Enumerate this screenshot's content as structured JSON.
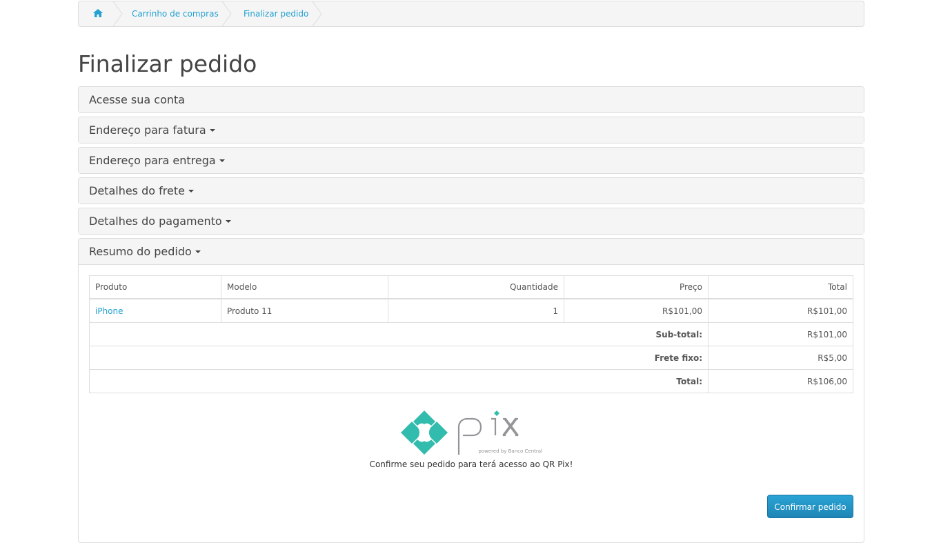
{
  "breadcrumb": {
    "home_icon": "home-icon",
    "items": [
      "Carrinho de compras",
      "Finalizar pedido"
    ]
  },
  "page_title": "Finalizar pedido",
  "panels": {
    "account": "Acesse sua conta",
    "billing": "Endereço para fatura",
    "shipping_address": "Endereço para entrega",
    "shipping_method": "Detalhes do frete",
    "payment": "Detalhes do pagamento",
    "summary": "Resumo do pedido"
  },
  "table": {
    "headers": [
      "Produto",
      "Modelo",
      "Quantidade",
      "Preço",
      "Total"
    ],
    "rows": [
      {
        "product": "iPhone",
        "model": "Produto 11",
        "quantity": "1",
        "price": "R$101,00",
        "total": "R$101,00"
      }
    ],
    "totals": [
      {
        "label": "Sub-total:",
        "value": "R$101,00"
      },
      {
        "label": "Frete fixo:",
        "value": "R$5,00"
      },
      {
        "label": "Total:",
        "value": "R$106,00"
      }
    ]
  },
  "pix": {
    "logo_text": "pix",
    "logo_subtext": "powered by Banco Central",
    "message": "Confirme seu pedido para terá acesso ao QR Pix!"
  },
  "confirm_button": "Confirmar pedido",
  "colors": {
    "link": "#23a1d1",
    "pix": "#32bcad",
    "button": "#229ac8"
  }
}
